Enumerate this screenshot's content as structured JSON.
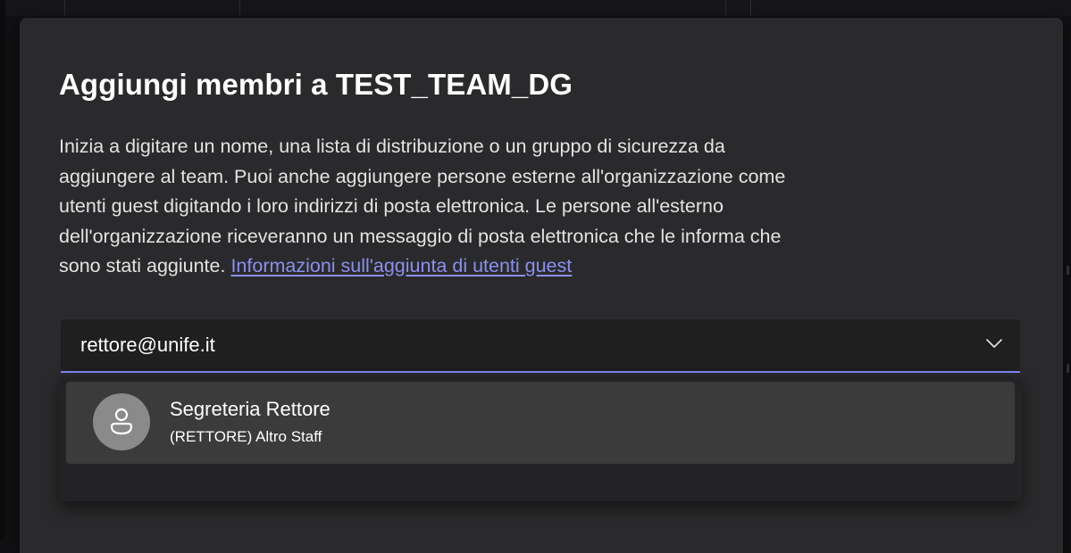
{
  "dialog": {
    "title": "Aggiungi membri a TEST_TEAM_DG",
    "description_lines": [
      "Inizia a digitare un nome, una lista di distribuzione o un gruppo di sicurezza da",
      "aggiungere al team. Puoi anche aggiungere persone esterne all'organizzazione come",
      "utenti guest digitando i loro indirizzi di posta elettronica. Le persone all'esterno",
      "dell'organizzazione riceveranno un messaggio di posta elettronica che le informa che",
      "sono stati aggiunte."
    ],
    "link_text": "Informazioni sull'aggiunta di utenti guest"
  },
  "picker": {
    "value": "rettore@unife.it",
    "icon": "chevron-down-icon"
  },
  "suggestions": [
    {
      "name": "Segreteria Rettore",
      "subtitle": "(RETTORE) Altro Staff",
      "avatar_icon": "person-icon"
    }
  ],
  "colors": {
    "dialog_bg": "#2a2a2c",
    "input_bg": "#1f1f1f",
    "accent": "#7f85f5",
    "link": "#8b8ff0",
    "suggestion_bg": "#3b3b3b",
    "avatar_bg": "#8a8a8a"
  }
}
